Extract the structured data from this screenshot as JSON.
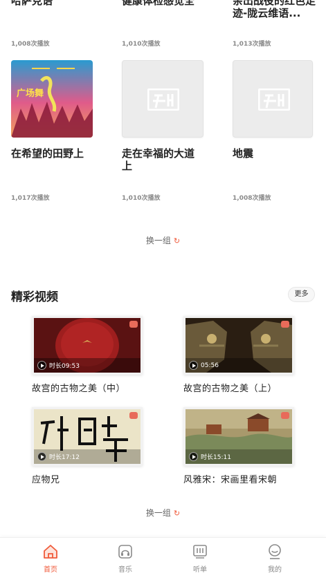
{
  "audio": {
    "row1": [
      {
        "title": "哈萨克语",
        "plays": "1,008次播放"
      },
      {
        "title": "健康体检感觉全",
        "plays": "1,010次播放"
      },
      {
        "title": "亲出战役的红色足迹-陇云维语...",
        "plays": "1,013次播放"
      }
    ],
    "row2": [
      {
        "title": "在希望的田野上",
        "plays": "1,017次播放",
        "art_caption": "广场舞"
      },
      {
        "title": "走在幸福的大道上",
        "plays": "1,010次播放"
      },
      {
        "title": "地震",
        "plays": "1,008次播放"
      }
    ],
    "refresh_label": "换一组"
  },
  "videos": {
    "section_title": "精彩视频",
    "more_label": "更多",
    "items": [
      {
        "title": "故宫的古物之美（中）",
        "duration": "时长09:53",
        "theme": "#7a1818"
      },
      {
        "title": "故宫的古物之美（上）",
        "duration": "05:56",
        "theme": "#3a2a18"
      },
      {
        "title": "应物兄",
        "duration": "时长17:12",
        "theme": "#e9e2c6"
      },
      {
        "title": "风雅宋：宋画里看宋朝",
        "duration": "时长15:11",
        "theme": "#9b8a5e"
      }
    ],
    "refresh_label": "换一组"
  },
  "tabbar": {
    "items": [
      {
        "label": "首页",
        "icon": "home-icon",
        "active": true
      },
      {
        "label": "音乐",
        "icon": "music-icon",
        "active": false
      },
      {
        "label": "听单",
        "icon": "playlist-icon",
        "active": false
      },
      {
        "label": "我的",
        "icon": "profile-icon",
        "active": false
      }
    ]
  },
  "colors": {
    "accent": "#f05a3a",
    "muted": "#8a8a8a"
  }
}
